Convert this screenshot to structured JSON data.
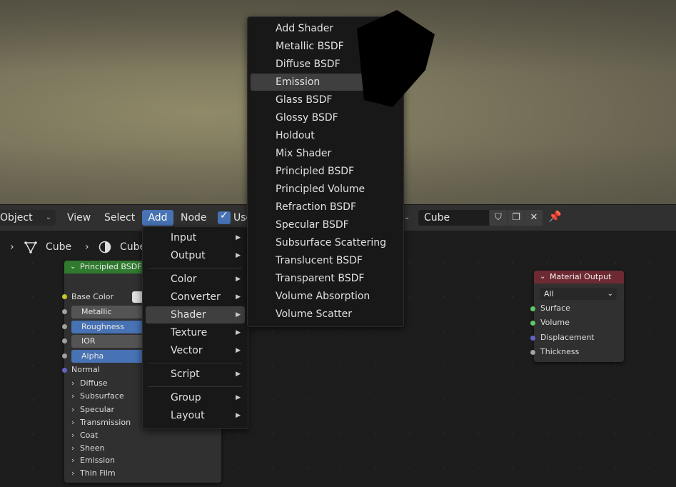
{
  "header": {
    "editor_type": "Object",
    "menus": [
      "View",
      "Select",
      "Add",
      "Node"
    ],
    "use_nodes_label": "Use",
    "material_name": "Cube"
  },
  "breadcrumb": [
    "Cube",
    "Cube"
  ],
  "principled_node": {
    "title": "Principled BSDF",
    "base_color": "Base Color",
    "inputs": [
      "Metallic",
      "Roughness",
      "IOR",
      "Alpha"
    ],
    "normal": "Normal",
    "panels": [
      "Diffuse",
      "Subsurface",
      "Specular",
      "Transmission",
      "Coat",
      "Sheen",
      "Emission",
      "Thin Film"
    ]
  },
  "output_node": {
    "title": "Material Output",
    "target": "All",
    "sockets": [
      "Surface",
      "Volume",
      "Displacement",
      "Thickness"
    ]
  },
  "add_menu": {
    "group1": [
      "Input",
      "Output"
    ],
    "group2": [
      "Color",
      "Converter",
      "Shader",
      "Texture",
      "Vector"
    ],
    "group3": [
      "Script"
    ],
    "group4": [
      "Group",
      "Layout"
    ],
    "active": "Shader"
  },
  "shader_menu": {
    "items": [
      "Add Shader",
      "Metallic BSDF",
      "Diffuse BSDF",
      "Emission",
      "Glass BSDF",
      "Glossy BSDF",
      "Holdout",
      "Mix Shader",
      "Principled BSDF",
      "Principled Volume",
      "Refraction BSDF",
      "Specular BSDF",
      "Subsurface Scattering",
      "Translucent BSDF",
      "Transparent BSDF",
      "Volume Absorption",
      "Volume Scatter"
    ],
    "active": "Emission"
  },
  "colors": {
    "accent": "#4772b3",
    "shader_node": "#2f7a2f",
    "output_node": "#6e2a33"
  }
}
